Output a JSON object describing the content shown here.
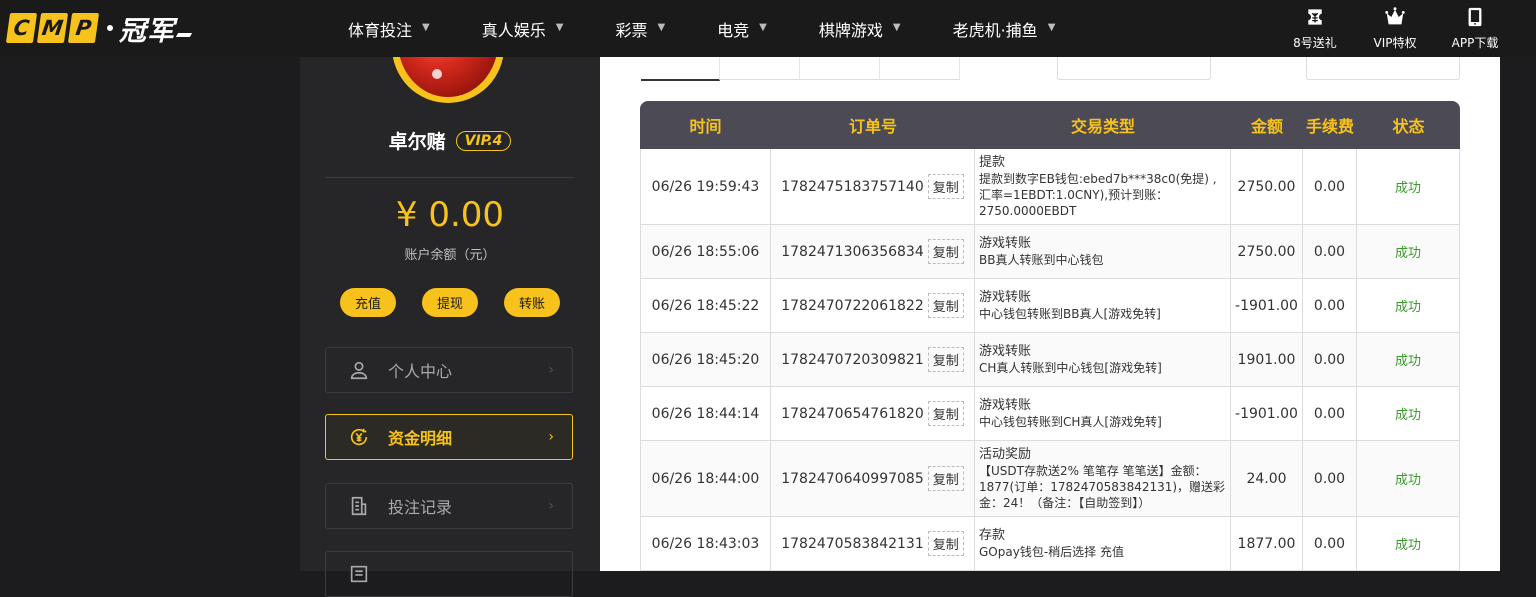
{
  "logo": {
    "letters": [
      "C",
      "M",
      "P"
    ],
    "name": "冠军"
  },
  "nav": [
    {
      "label": "体育投注"
    },
    {
      "label": "真人娱乐"
    },
    {
      "label": "彩票"
    },
    {
      "label": "电竞"
    },
    {
      "label": "棋牌游戏"
    },
    {
      "label": "老虎机·捕鱼"
    }
  ],
  "right_links": [
    {
      "label": "8号送礼",
      "icon": "gift-ticket-icon"
    },
    {
      "label": "VIP特权",
      "icon": "crown-icon"
    },
    {
      "label": "APP下载",
      "icon": "phone-icon"
    }
  ],
  "user": {
    "name": "卓尔赌",
    "vip": "VIP.4",
    "balance": "¥ 0.00",
    "balance_label": "账户余额（元）"
  },
  "actions": [
    "充值",
    "提现",
    "转账"
  ],
  "menu": [
    {
      "label": "个人中心",
      "icon": "user-icon"
    },
    {
      "label": "资金明细",
      "icon": "yen-circle-icon",
      "active": true
    },
    {
      "label": "投注记录",
      "icon": "document-icon"
    },
    {
      "label": "",
      "icon": "profile-icon"
    }
  ],
  "table": {
    "headers": [
      "时间",
      "订单号",
      "交易类型",
      "金额",
      "手续费",
      "状态"
    ],
    "copy_label": "复制",
    "rows": [
      {
        "time": "06/26 19:59:43",
        "order": "1782475183757140",
        "type": "提款",
        "desc": "提款到数字EB钱包:ebed7b***38c0(免提) ,汇率=1EBDT:1.0CNY),预计到账：2750.0000EBDT",
        "amount": "2750.00",
        "fee": "0.00",
        "status": "成功"
      },
      {
        "time": "06/26 18:55:06",
        "order": "1782471306356834",
        "type": "游戏转账",
        "desc": "BB真人转账到中心钱包",
        "amount": "2750.00",
        "fee": "0.00",
        "status": "成功"
      },
      {
        "time": "06/26 18:45:22",
        "order": "1782470722061822",
        "type": "游戏转账",
        "desc": "中心钱包转账到BB真人[游戏免转]",
        "amount": "-1901.00",
        "fee": "0.00",
        "status": "成功"
      },
      {
        "time": "06/26 18:45:20",
        "order": "1782470720309821",
        "type": "游戏转账",
        "desc": "CH真人转账到中心钱包[游戏免转]",
        "amount": "1901.00",
        "fee": "0.00",
        "status": "成功"
      },
      {
        "time": "06/26 18:44:14",
        "order": "1782470654761820",
        "type": "游戏转账",
        "desc": "中心钱包转账到CH真人[游戏免转]",
        "amount": "-1901.00",
        "fee": "0.00",
        "status": "成功"
      },
      {
        "time": "06/26 18:44:00",
        "order": "1782470640997085",
        "type": "活动奖励",
        "desc": "【USDT存款送2% 笔笔存 笔笔送】金额：1877(订单：1782470583842131)，赠送彩金：24！（备注：【自助签到】）",
        "amount": "24.00",
        "fee": "0.00",
        "status": "成功"
      },
      {
        "time": "06/26 18:43:03",
        "order": "1782470583842131",
        "type": "存款",
        "desc": "GOpay钱包-稍后选择 充值",
        "amount": "1877.00",
        "fee": "0.00",
        "status": "成功"
      }
    ]
  }
}
